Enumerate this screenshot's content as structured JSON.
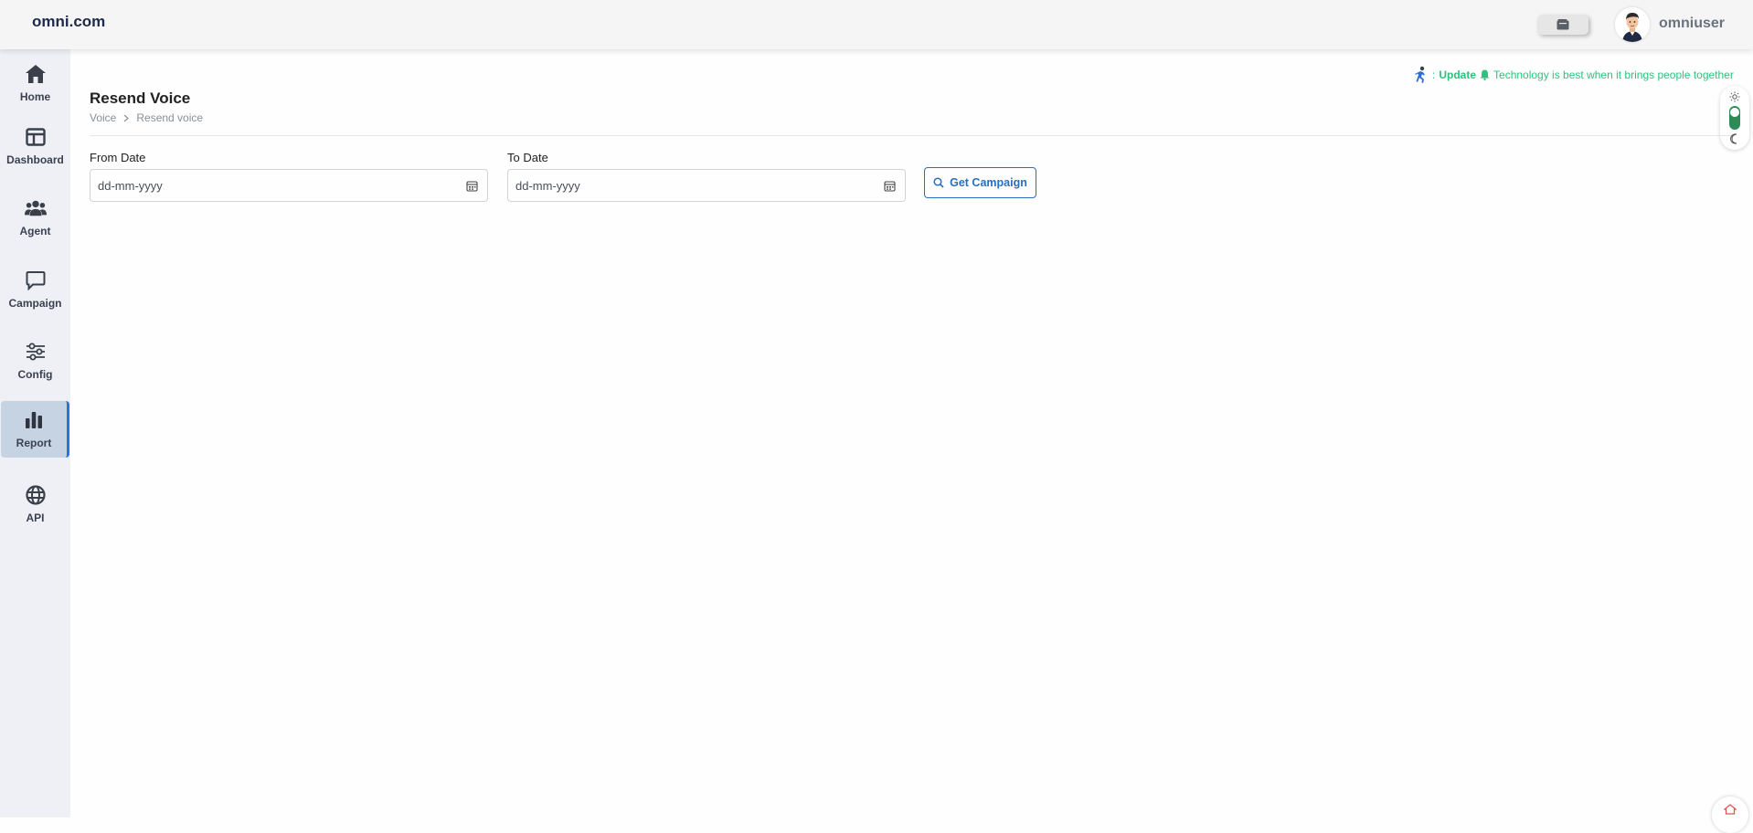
{
  "header": {
    "brand": "omni.com",
    "username": "omniuser",
    "wallet_icon": "wallet-icon",
    "avatar_icon": "user-avatar"
  },
  "sidebar": {
    "items": [
      {
        "label": "Home",
        "icon": "home-icon",
        "active": false
      },
      {
        "label": "Dashboard",
        "icon": "dashboard-icon",
        "active": false
      },
      {
        "label": "Agent",
        "icon": "users-icon",
        "active": false
      },
      {
        "label": "Campaign",
        "icon": "chat-icon",
        "active": false
      },
      {
        "label": "Config",
        "icon": "sliders-icon",
        "active": false
      },
      {
        "label": "Report",
        "icon": "bar-chart-icon",
        "active": true
      },
      {
        "label": "API",
        "icon": "globe-icon",
        "active": false
      }
    ]
  },
  "update": {
    "prefix": ": ",
    "label": "Update",
    "message": "Technology is best when it brings people together"
  },
  "page": {
    "title": "Resend Voice",
    "breadcrumb": [
      "Voice",
      "Resend voice"
    ]
  },
  "form": {
    "from_label": "From Date",
    "from_placeholder": "dd-mm-yyyy",
    "to_label": "To Date",
    "to_placeholder": "dd-mm-yyyy",
    "submit_label": "Get Campaign"
  },
  "colors": {
    "accent": "#2a6fbf",
    "active_nav": "#c5d3e2",
    "update_text": "#2ec27e",
    "toggle": "#2e8b57"
  }
}
